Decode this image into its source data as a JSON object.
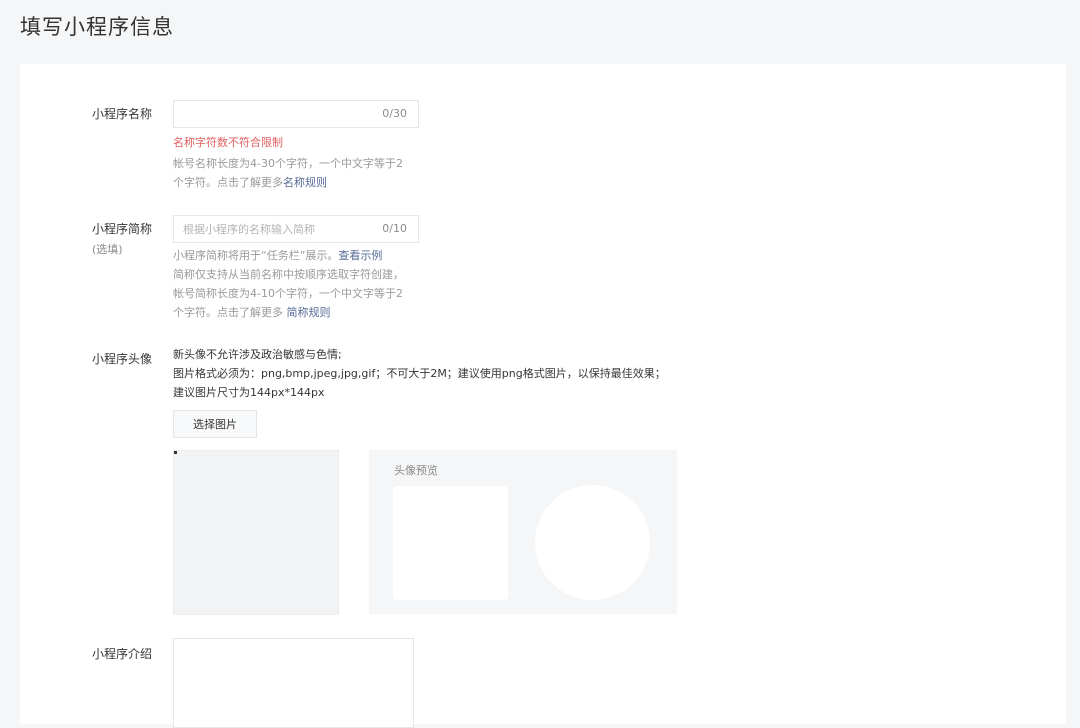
{
  "page": {
    "title": "填写小程序信息"
  },
  "name_field": {
    "label": "小程序名称",
    "value": "",
    "counter": "0/30",
    "error": "名称字符数不符合限制",
    "tip_line1": "帐号名称长度为4-30个字符，一个中文字等于2",
    "tip_line2_prefix": "个字符。点击了解更多",
    "tip_link": "名称规则"
  },
  "short_name_field": {
    "label": "小程序简称",
    "label_sub": "(选填)",
    "placeholder": "根据小程序的名称输入简称",
    "counter": "0/10",
    "tip_line1_prefix": "小程序简称将用于“任务栏”展示。",
    "tip_line1_link": "查看示例",
    "tip_line2": "简称仅支持从当前名称中按顺序选取字符创建，",
    "tip_line3": "帐号简称长度为4-10个字符，一个中文字等于2",
    "tip_line4_prefix": "个字符。点击了解更多 ",
    "tip_line4_link": "简称规则"
  },
  "avatar_field": {
    "label": "小程序头像",
    "desc_line1": "新头像不允许涉及政治敏感与色情;",
    "desc_line2": "图片格式必须为：png,bmp,jpeg,jpg,gif；不可大于2M；建议使用png格式图片，以保持最佳效果；",
    "desc_line3": "建议图片尺寸为144px*144px",
    "select_button": "选择图片",
    "preview_title": "头像预览"
  },
  "intro_field": {
    "label": "小程序介绍",
    "value": ""
  }
}
